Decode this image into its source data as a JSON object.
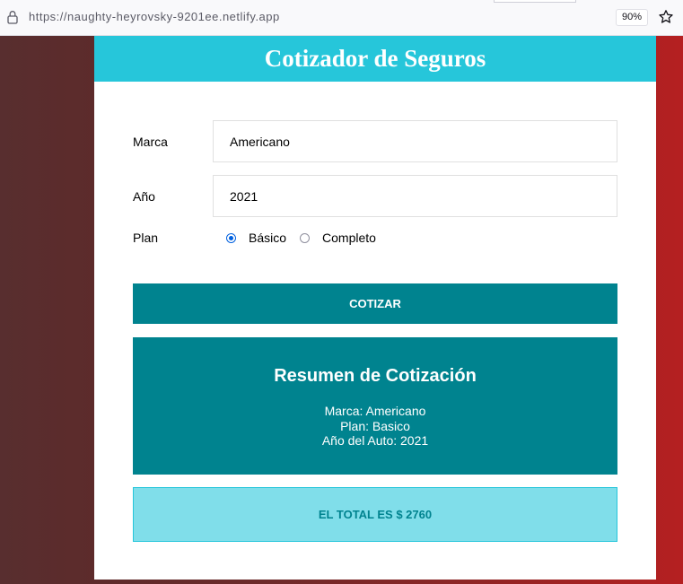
{
  "browser": {
    "url": "https://naughty-heyrovsky-9201ee.netlify.app",
    "zoom": "90%"
  },
  "header": {
    "title": "Cotizador de Seguros"
  },
  "form": {
    "marca": {
      "label": "Marca",
      "value": "Americano"
    },
    "anio": {
      "label": "Año",
      "value": "2021"
    },
    "plan": {
      "label": "Plan",
      "options": [
        {
          "label": "Básico",
          "checked": true
        },
        {
          "label": "Completo",
          "checked": false
        }
      ]
    },
    "submit_label": "COTIZAR"
  },
  "resumen": {
    "title": "Resumen de Cotización",
    "marca_line": "Marca: Americano",
    "plan_line": "Plan: Basico",
    "anio_line": "Año del Auto: 2021"
  },
  "total": {
    "text": "EL TOTAL ES $ 2760"
  },
  "colors": {
    "header_bg": "#26c6da",
    "primary": "#00838f",
    "total_bg": "#80deea"
  }
}
